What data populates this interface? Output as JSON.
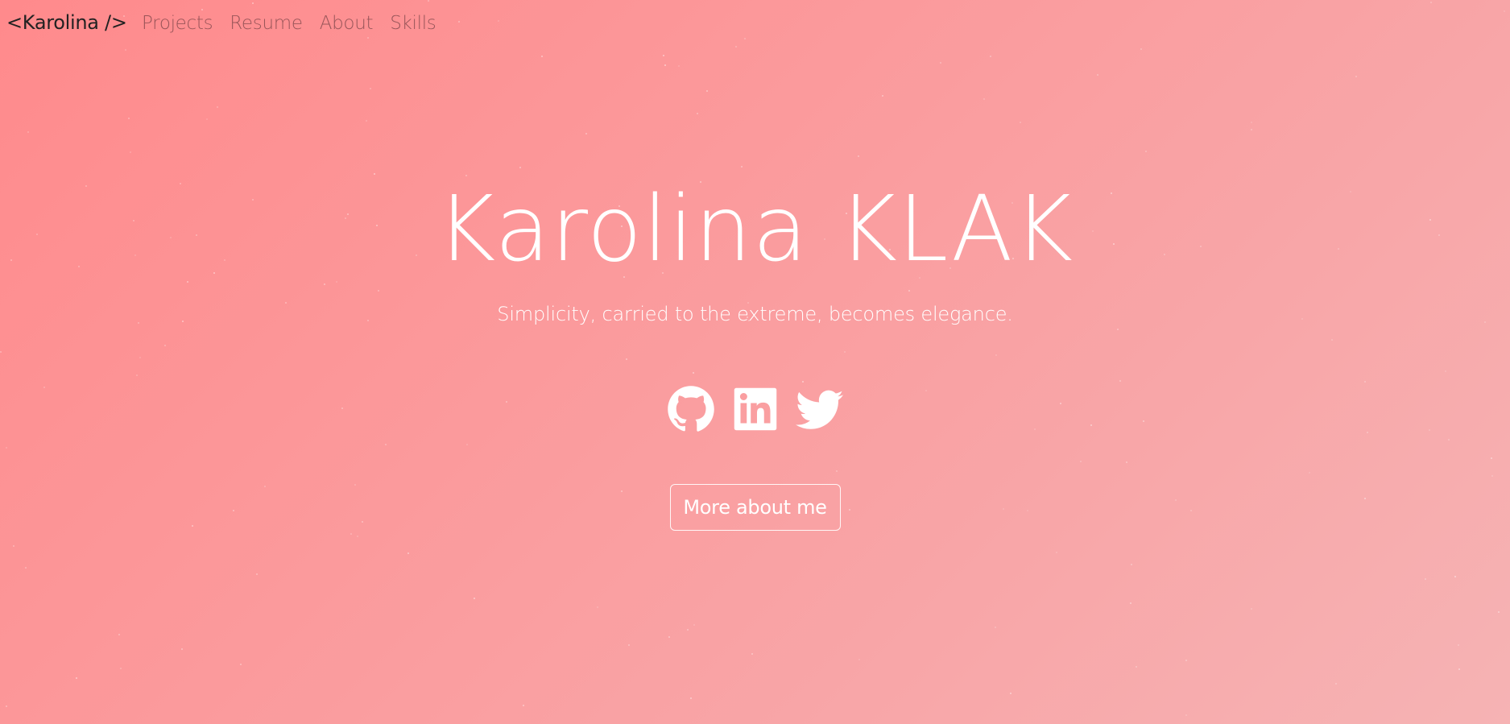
{
  "colors": {
    "background_start": "#ff8a8c",
    "background_end": "#f6b3b4",
    "text_primary": "#ffffff",
    "brand_text": "#222222"
  },
  "nav": {
    "brand": "<Karolina />",
    "links": [
      {
        "label": "Projects"
      },
      {
        "label": "Resume"
      },
      {
        "label": "About"
      },
      {
        "label": "Skills"
      }
    ]
  },
  "hero": {
    "title": "Karolina KLAK",
    "subtitle": "Simplicity, carried to the extreme, becomes elegance."
  },
  "socials": [
    {
      "icon": "github-icon"
    },
    {
      "icon": "linkedin-icon"
    },
    {
      "icon": "twitter-icon"
    }
  ],
  "cta": {
    "label": "More about me"
  }
}
